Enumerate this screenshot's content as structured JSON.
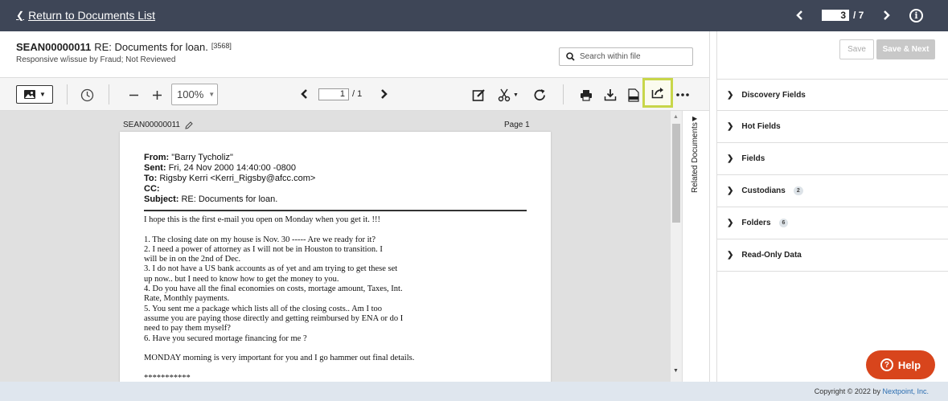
{
  "topbar": {
    "back_label": "Return to Documents List",
    "current_doc": "3",
    "total_docs": "/ 7"
  },
  "doc": {
    "bates": "SEAN00000011",
    "subject": "RE: Documents for loan.",
    "doc_id": "[3568]",
    "status": "Responsive w/issue by Fraud; Not Reviewed"
  },
  "search": {
    "placeholder": "Search within file"
  },
  "toolbar": {
    "zoom": "100%",
    "page_current": "1",
    "page_total": "/ 1"
  },
  "viewer": {
    "page_name": "SEAN00000011",
    "page_label": "Page 1",
    "related_label": "Related Documents"
  },
  "email": {
    "from_label": "From:",
    "from": "\"Barry Tycholiz\"",
    "sent_label": "Sent:",
    "sent": "Fri, 24 Nov 2000 14:40:00 -0800",
    "to_label": "To:",
    "to": "Rigsby Kerri <Kerri_Rigsby@afcc.com>",
    "cc_label": "CC:",
    "subject_label": "Subject:",
    "subject": "RE: Documents for loan.",
    "body": [
      "I hope this is the first e-mail you open on Monday when you get it. !!!",
      "",
      "1. The closing date on my house is Nov. 30  ----- Are we ready for it?",
      "2. I need a power of attorney as I will not be in Houston to transition.  I",
      "will be in on the 2nd of Dec.",
      "3.  I do not have a US bank accounts as of yet and am trying to get these set",
      "up now.. but I need to know how to get the money to you.",
      "4.  Do you have all the final economies on costs, mortage amount, Taxes, Int.",
      "Rate, Monthly payments.",
      "5. You sent me a package which lists all of the closing costs.. Am I too",
      "assume you are paying those directly and getting reimbursed by ENA or do I",
      "need to pay them myself?",
      "6. Have you secured mortage financing for me ?",
      "",
      "MONDAY morning is very important for you and I go hammer out final details.",
      "",
      "***********"
    ]
  },
  "panel": {
    "save_label": "Save",
    "save_next_label": "Save & Next",
    "fields": [
      {
        "label": "Discovery Fields",
        "count": ""
      },
      {
        "label": "Hot Fields",
        "count": ""
      },
      {
        "label": "Fields",
        "count": ""
      },
      {
        "label": "Custodians",
        "count": "2"
      },
      {
        "label": "Folders",
        "count": "6"
      },
      {
        "label": "Read-Only Data",
        "count": ""
      }
    ]
  },
  "help_label": "Help",
  "footer": {
    "copyright": "Copyright © 2022 by",
    "company": "Nextpoint, Inc."
  },
  "colors": {
    "topbar": "#3e4657",
    "help": "#d8451c",
    "highlight": "#c8d64a"
  }
}
